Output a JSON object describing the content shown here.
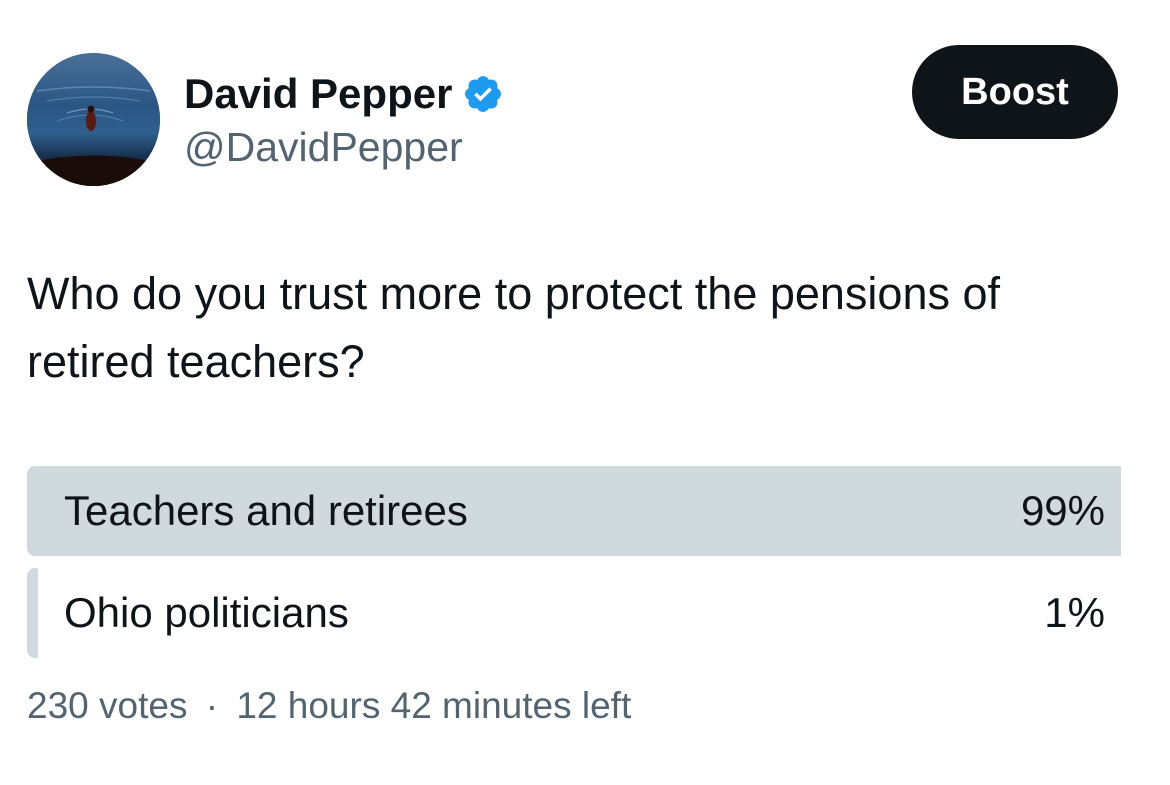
{
  "author": {
    "name": "David Pepper",
    "handle": "@DavidPepper",
    "verified_icon": "verified-badge-icon",
    "verified_color": "#1d9bf0"
  },
  "boost_button": {
    "label": "Boost"
  },
  "tweet": {
    "text": "Who do you trust more to protect the pensions of retired teachers?"
  },
  "poll": {
    "options": [
      {
        "label": "Teachers and retirees",
        "percent_text": "99%",
        "fraction": 0.99
      },
      {
        "label": "Ohio politicians",
        "percent_text": "1%",
        "fraction": 0.01
      }
    ],
    "votes": "230 votes",
    "separator": "·",
    "time_left": "12 hours 42 minutes left",
    "bar_color": "#cfd9de"
  }
}
